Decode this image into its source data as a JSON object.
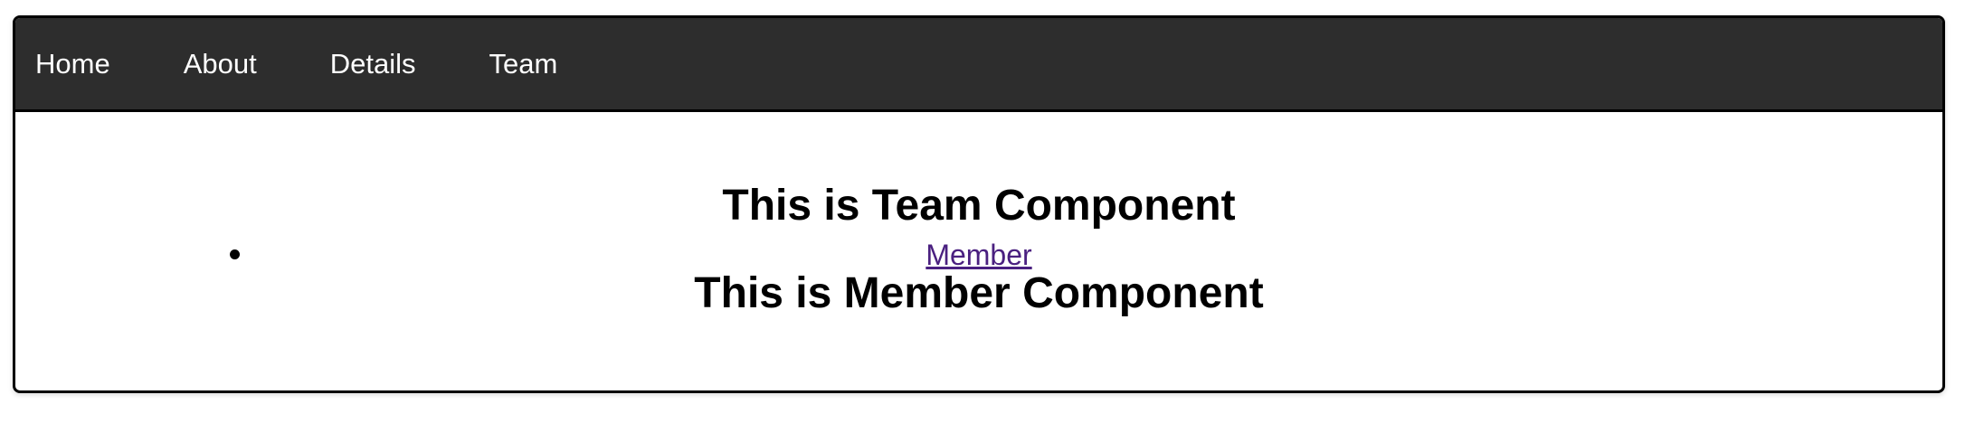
{
  "nav": {
    "items": [
      {
        "label": "Home"
      },
      {
        "label": "About"
      },
      {
        "label": "Details"
      },
      {
        "label": "Team"
      }
    ]
  },
  "main": {
    "team_heading": "This is Team Component",
    "member_link": "Member",
    "member_heading": "This is Member Component"
  },
  "colors": {
    "navbar_bg": "#2d2d2d",
    "nav_text": "#ffffff",
    "link_visited": "#4a2080"
  }
}
